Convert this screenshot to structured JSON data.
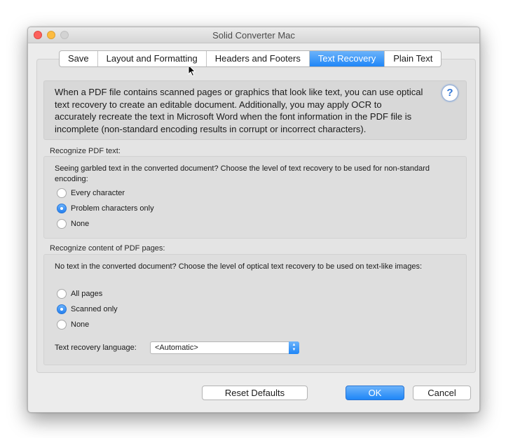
{
  "window": {
    "title": "Solid Converter Mac"
  },
  "tabs": [
    {
      "label": "Save",
      "active": false
    },
    {
      "label": "Layout and Formatting",
      "active": false
    },
    {
      "label": "Headers and Footers",
      "active": false
    },
    {
      "label": "Text Recovery",
      "active": true
    },
    {
      "label": "Plain Text",
      "active": false
    }
  ],
  "info": {
    "text": "When a PDF file contains scanned pages or graphics that look like text, you can use optical text recovery to create an editable document. Additionally, you may apply OCR to accurately recreate the text in Microsoft Word when the font information in the PDF file is incomplete (non-standard encoding results in corrupt or incorrect characters).",
    "help_label": "?"
  },
  "recognize_text": {
    "section_label": "Recognize PDF text:",
    "description": "Seeing garbled text in the converted document? Choose the level of text recovery to be used for non-standard encoding:",
    "options": [
      {
        "label": "Every character",
        "checked": false
      },
      {
        "label": "Problem characters only",
        "checked": true
      },
      {
        "label": "None",
        "checked": false
      }
    ]
  },
  "recognize_pages": {
    "section_label": "Recognize content of PDF pages:",
    "description": "No text in the converted document? Choose the level of optical text recovery to be used on text-like images:",
    "options": [
      {
        "label": "All pages",
        "checked": false
      },
      {
        "label": "Scanned only",
        "checked": true
      },
      {
        "label": "None",
        "checked": false
      }
    ],
    "language_label": "Text recovery language:",
    "language_value": "<Automatic>"
  },
  "buttons": {
    "reset": "Reset Defaults",
    "ok": "OK",
    "cancel": "Cancel"
  },
  "colors": {
    "accent": "#1f86f7",
    "close": "#fc605c",
    "minimize": "#fdbc40"
  }
}
